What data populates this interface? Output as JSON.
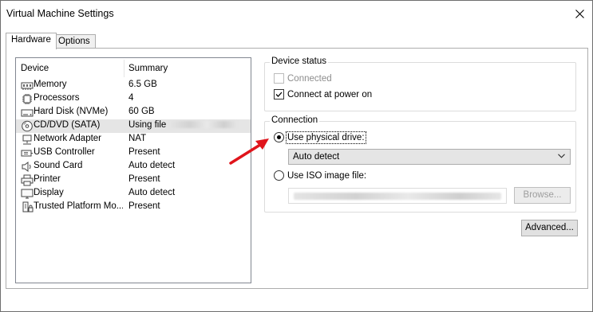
{
  "window": {
    "title": "Virtual Machine Settings"
  },
  "tabs": [
    {
      "label": "Hardware",
      "active": true
    },
    {
      "label": "Options",
      "active": false
    }
  ],
  "device_list": {
    "columns": [
      "Device",
      "Summary"
    ],
    "rows": [
      {
        "name": "Memory",
        "summary": "6.5 GB",
        "icon": "memory-icon"
      },
      {
        "name": "Processors",
        "summary": "4",
        "icon": "processor-icon"
      },
      {
        "name": "Hard Disk (NVMe)",
        "summary": "60 GB",
        "icon": "hard-disk-icon"
      },
      {
        "name": "CD/DVD (SATA)",
        "summary": "Using file",
        "icon": "cd-dvd-icon",
        "selected": true
      },
      {
        "name": "Network Adapter",
        "summary": "NAT",
        "icon": "network-adapter-icon"
      },
      {
        "name": "USB Controller",
        "summary": "Present",
        "icon": "usb-icon"
      },
      {
        "name": "Sound Card",
        "summary": "Auto detect",
        "icon": "speaker-icon"
      },
      {
        "name": "Printer",
        "summary": "Present",
        "icon": "printer-icon"
      },
      {
        "name": "Display",
        "summary": "Auto detect",
        "icon": "monitor-icon"
      },
      {
        "name": "Trusted Platform Mo...",
        "summary": "Present",
        "icon": "tpm-icon"
      }
    ]
  },
  "device_status": {
    "legend": "Device status",
    "connected_label": "Connected",
    "connected_checked": false,
    "connected_disabled": true,
    "connect_power_label": "Connect at power on",
    "connect_power_checked": true
  },
  "connection": {
    "legend": "Connection",
    "physical_label": "Use physical drive:",
    "physical_selected": true,
    "drive_value": "Auto detect",
    "iso_label": "Use ISO image file:",
    "iso_selected": false,
    "browse_label": "Browse..."
  },
  "advanced_label": "Advanced...",
  "colors": {
    "annotation_arrow": "#e0141b",
    "selection": "#e5e5e5"
  }
}
